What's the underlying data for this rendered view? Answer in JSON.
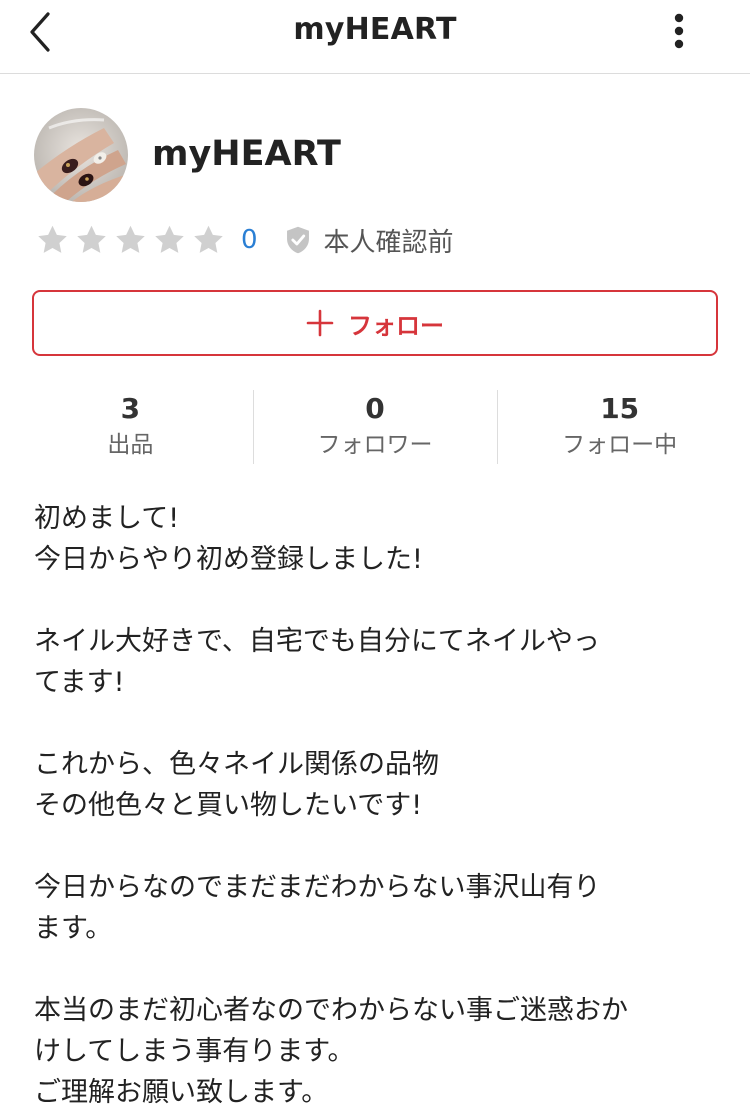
{
  "header": {
    "title": "myHEART",
    "back_icon": "chevron-left-icon",
    "more_icon": "more-vertical-icon"
  },
  "profile": {
    "avatar_icon": "avatar-nail-photo",
    "name": "myHEART",
    "rating": {
      "stars_filled": 0,
      "stars_total": 5,
      "count": "0"
    },
    "verification": {
      "icon": "shield-check-icon",
      "text": "本人確認前"
    }
  },
  "follow_button": {
    "icon": "plus-icon",
    "label": "フォロー"
  },
  "stats": [
    {
      "value": "3",
      "label": "出品"
    },
    {
      "value": "0",
      "label": "フォロワー"
    },
    {
      "value": "15",
      "label": "フォロー中"
    }
  ],
  "bio": {
    "lines": [
      "初めまして!",
      "今日からやり初め登録しました!",
      "",
      "ネイル大好きで、自宅でも自分にてネイルやっ",
      "てます!",
      "",
      "これから、色々ネイル関係の品物",
      "その他色々と買い物したいです!",
      "",
      "今日からなのでまだまだわからない事沢山有り",
      "ます。",
      "",
      "本当のまだ初心者なのでわからない事ご迷惑おか",
      "けしてしまう事有ります。",
      "ご理解お願い致します。"
    ]
  },
  "colors": {
    "accent": "#d6353b",
    "link": "#2a7fd4",
    "star_empty": "#d0d0d0",
    "divider": "#dcdcdc"
  }
}
